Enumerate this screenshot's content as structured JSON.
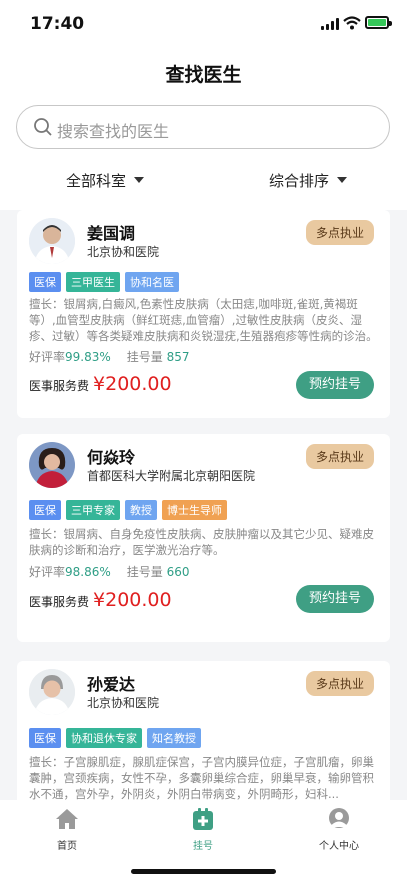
{
  "status": {
    "time": "17:40"
  },
  "header": {
    "title": "查找医生",
    "search_placeholder": "搜索查找的医生"
  },
  "filters": {
    "department": "全部科室",
    "sort": "综合排序"
  },
  "labels": {
    "rating": "好评率",
    "bookings": "挂号量",
    "fee": "医事服务费",
    "book": "预约挂号",
    "multi": "多点执业"
  },
  "doctors": [
    {
      "name": "姜国调",
      "hospital": "北京协和医院",
      "tags": [
        "医保",
        "三甲医生",
        "协和名医"
      ],
      "desc": "擅长：银屑病,白癜风,色素性皮肤病（太田痣,咖啡斑,雀斑,黄褐斑等）,血管型皮肤病（鲜红斑痣,血管瘤）,过敏性皮肤病（皮炎、湿疹、过敏）等各类疑难皮肤病和炎锐湿疣,生殖器疱疹等性病的诊治。",
      "rating": "99.83%",
      "bookings": "857",
      "price": "¥200.00"
    },
    {
      "name": "何焱玲",
      "hospital": "首都医科大学附属北京朝阳医院",
      "tags": [
        "医保",
        "三甲专家",
        "教授",
        "博士生导师"
      ],
      "desc": "擅长：银屑病、自身免疫性皮肤病、皮肤肿瘤以及其它少见、疑难皮肤病的诊断和治疗，医学激光治疗等。",
      "rating": "98.86%",
      "bookings": "660",
      "price": "¥200.00"
    },
    {
      "name": "孙爱达",
      "hospital": "北京协和医院",
      "tags": [
        "医保",
        "协和退休专家",
        "知名教授"
      ],
      "desc": "擅长：子宫腺肌症，腺肌症保宫，子宫内膜异位症，子宫肌瘤，卵巢囊肿，宫颈疾病，女性不孕，多囊卵巢综合症，卵巢早衰，输卵管积水不通，宫外孕，外阴炎，外阴白带病变，外阴畸形，妇科..."
    }
  ],
  "tabs": [
    "首页",
    "挂号",
    "个人中心"
  ],
  "colors": {
    "accent": "#3f9f84",
    "price": "#e02020",
    "badge": "#e9c9a0"
  }
}
